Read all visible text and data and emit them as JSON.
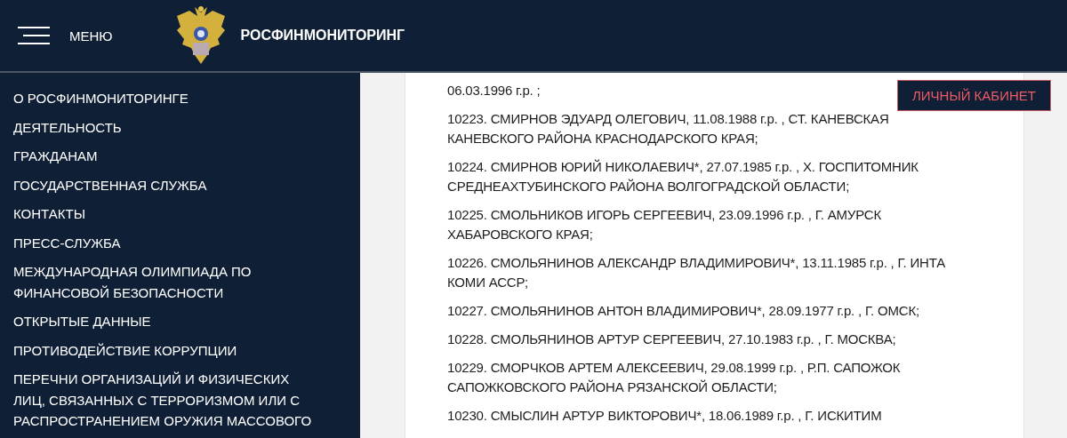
{
  "header": {
    "menu_label": "МЕНЮ",
    "site_title": "РОСФИНМОНИТОРИНГ"
  },
  "account_button": "ЛИЧНЫЙ КАБИНЕТ",
  "sidebar": {
    "items": [
      {
        "lines": [
          "О РОСФИНМОНИТОРИНГЕ"
        ]
      },
      {
        "lines": [
          "ДЕЯТЕЛЬНОСТЬ"
        ]
      },
      {
        "lines": [
          "ГРАЖДАНАМ"
        ]
      },
      {
        "lines": [
          "ГОСУДАРСТВЕННАЯ СЛУЖБА"
        ]
      },
      {
        "lines": [
          "КОНТАКТЫ"
        ]
      },
      {
        "lines": [
          "ПРЕСС-СЛУЖБА"
        ]
      },
      {
        "lines": [
          "МЕЖДУНАРОДНАЯ ОЛИМПИАДА ПО",
          "ФИНАНСОВОЙ БЕЗОПАСНОСТИ"
        ]
      },
      {
        "lines": [
          "ОТКРЫТЫЕ ДАННЫЕ"
        ]
      },
      {
        "lines": [
          "ПРОТИВОДЕЙСТВИЕ КОРРУПЦИИ"
        ]
      },
      {
        "lines": [
          "ПЕРЕЧНИ ОРГАНИЗАЦИЙ И ФИЗИЧЕСКИХ",
          "ЛИЦ, СВЯЗАННЫХ С ТЕРРОРИЗМОМ ИЛИ С",
          "РАСПРОСТРАНЕНИЕМ ОРУЖИЯ МАССОВОГО"
        ]
      }
    ]
  },
  "entries": [
    {
      "lines": [
        "06.03.1996 г.р. ;"
      ]
    },
    {
      "lines": [
        "10223. СМИРНОВ ЭДУАРД ОЛЕГОВИЧ, 11.08.1988 г.р. , СТ. КАНЕВСКАЯ",
        "КАНЕВСКОГО РАЙОНА КРАСНОДАРСКОГО КРАЯ;"
      ]
    },
    {
      "lines": [
        "10224. СМИРНОВ ЮРИЙ НИКОЛАЕВИЧ*, 27.07.1985 г.р. , Х. ГОСПИТОМНИК",
        "СРЕДНЕАХТУБИНСКОГО РАЙОНА ВОЛГОГРАДСКОЙ ОБЛАСТИ;"
      ]
    },
    {
      "lines": [
        "10225. СМОЛЬНИКОВ ИГОРЬ СЕРГЕЕВИЧ, 23.09.1996 г.р. , Г. АМУРСК",
        "ХАБАРОВСКОГО КРАЯ;"
      ]
    },
    {
      "lines": [
        "10226. СМОЛЬЯНИНОВ АЛЕКСАНДР ВЛАДИМИРОВИЧ*, 13.11.1985 г.р. , Г. ИНТА",
        "КОМИ АССР;"
      ]
    },
    {
      "lines": [
        "10227. СМОЛЬЯНИНОВ АНТОН ВЛАДИМИРОВИЧ*, 28.09.1977 г.р. , Г. ОМСК;"
      ]
    },
    {
      "lines": [
        "10228. СМОЛЬЯНИНОВ АРТУР СЕРГЕЕВИЧ, 27.10.1983 г.р. , Г. МОСКВА;"
      ]
    },
    {
      "lines": [
        "10229. СМОРЧКОВ АРТЕМ АЛЕКСЕЕВИЧ, 29.08.1999 г.р. , Р.П. САПОЖОК",
        "САПОЖКОВСКОГО РАЙОНА РЯЗАНСКОЙ ОБЛАСТИ;"
      ]
    },
    {
      "lines": [
        "10230. СМЫСЛИН АРТУР ВИКТОРОВИЧ*, 18.06.1989 г.р. , Г. ИСКИТИМ"
      ]
    }
  ]
}
